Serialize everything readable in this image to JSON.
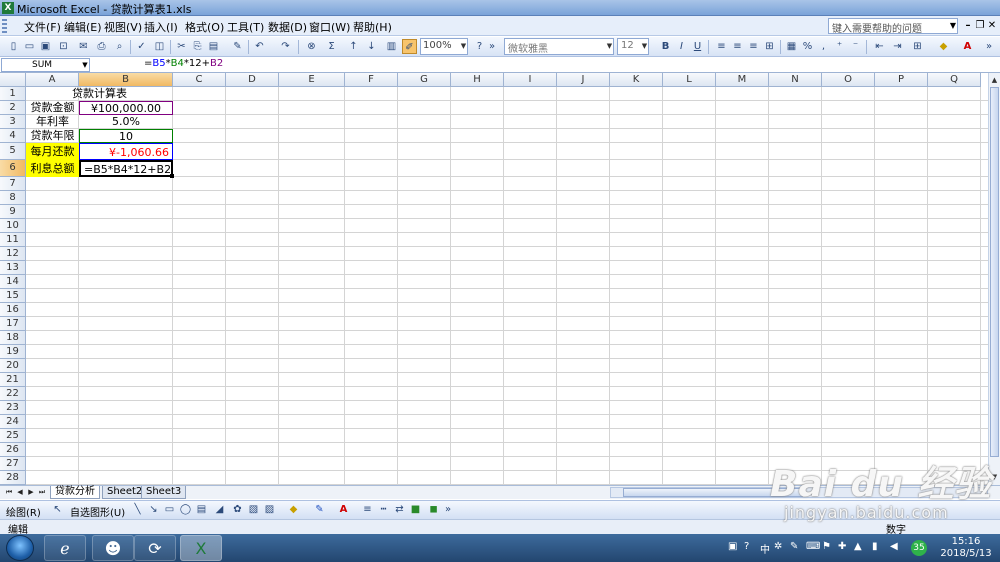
{
  "window": {
    "title": "Microsoft Excel - 贷款计算表1.xls"
  },
  "menu": {
    "items": [
      "文件(F)",
      "编辑(E)",
      "视图(V)",
      "插入(I)",
      "格式(O)",
      "工具(T)",
      "数据(D)",
      "窗口(W)",
      "帮助(H)"
    ],
    "help_placeholder": "键入需要帮助的问题"
  },
  "toolbar": {
    "zoom": "100%",
    "font_name": "微软雅黑",
    "font_size": "12"
  },
  "formula_bar": {
    "name_box": "SUM",
    "formula_parts": [
      {
        "text": "=",
        "color": "#000000"
      },
      {
        "text": "B5",
        "color": "#0000ff"
      },
      {
        "text": "*",
        "color": "#000000"
      },
      {
        "text": "B4",
        "color": "#008000"
      },
      {
        "text": "*12+",
        "color": "#000000"
      },
      {
        "text": "B2",
        "color": "#800080"
      }
    ]
  },
  "sheet": {
    "columns": [
      "A",
      "B",
      "C",
      "D",
      "E",
      "F",
      "G",
      "H",
      "I",
      "J",
      "K",
      "L",
      "M",
      "N",
      "O",
      "P",
      "Q"
    ],
    "rows": [
      "1",
      "2",
      "3",
      "4",
      "5",
      "6",
      "7",
      "8",
      "9",
      "10",
      "11",
      "12",
      "13",
      "14",
      "15",
      "16",
      "17",
      "18",
      "19",
      "20",
      "21",
      "22",
      "23",
      "24",
      "25",
      "26",
      "27",
      "28"
    ],
    "active_cell": "B6",
    "cells": {
      "title": "贷款计算表",
      "A2": "贷款金额",
      "B2": "¥100,000.00",
      "A3": "年利率",
      "B3": "5.0%",
      "A4": "贷款年限",
      "B4": "10",
      "A5": "每月还款",
      "B5": "¥-1,060.66",
      "A6": "利息总额",
      "B6": "=B5*B4*12+B2"
    },
    "colors": {
      "highlight": "#ffff00",
      "negative": "#ff0000",
      "ref_b2": "#800080",
      "ref_b4": "#008000",
      "ref_b5": "#0000ff"
    }
  },
  "sheet_tabs": [
    "贷款分析",
    "Sheet2",
    "Sheet3"
  ],
  "draw_toolbar": {
    "draw_label": "绘图(R)",
    "autoshape_label": "自选图形(U)"
  },
  "status": {
    "mode": "编辑",
    "num": "数字"
  },
  "taskbar": {
    "time": "15:16",
    "date": "2018/5/13",
    "ime": "中",
    "badge": "35"
  },
  "watermark": {
    "logo": "Bai du 经验",
    "sub": "jingyan.baidu.com"
  }
}
